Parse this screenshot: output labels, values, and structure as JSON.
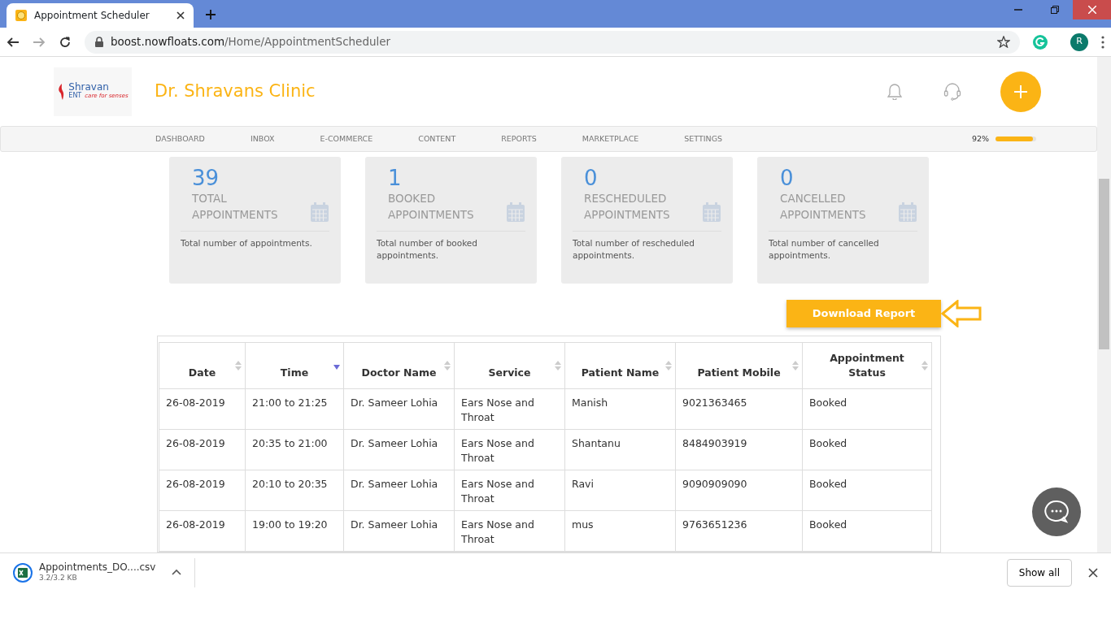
{
  "browser": {
    "tabs": [
      {
        "title": "Appointment Scheduler",
        "selected": true
      }
    ],
    "url_host": "boost.nowfloats.com",
    "url_path": "/Home/AppointmentScheduler",
    "profile_initial": "R"
  },
  "header": {
    "logo_name": "Shravan",
    "logo_sub": "ENT",
    "logo_tagline": "care for senses",
    "clinic_name": "Dr. Shravans Clinic"
  },
  "nav": {
    "items": [
      "DASHBOARD",
      "INBOX",
      "E-COMMERCE",
      "CONTENT",
      "REPORTS",
      "MARKETPLACE",
      "SETTINGS"
    ],
    "completion": "92%",
    "level": 0.92
  },
  "stats": [
    {
      "count": "39",
      "label_1": "TOTAL",
      "label_2": "APPOINTMENTS",
      "description": "Total number of appointments."
    },
    {
      "count": "1",
      "label_1": "BOOKED",
      "label_2": "APPOINTMENTS",
      "description": "Total number of booked appointments."
    },
    {
      "count": "0",
      "label_1": "RESCHEDULED",
      "label_2": "APPOINTMENTS",
      "description": "Total number of rescheduled appointments."
    },
    {
      "count": "0",
      "label_1": "CANCELLED",
      "label_2": "APPOINTMENTS",
      "description": "Total number of cancelled appointments."
    }
  ],
  "download_button": "Download Report",
  "table": {
    "columns": [
      {
        "label": "Date",
        "sorted": false
      },
      {
        "label": "Time",
        "sorted": true
      },
      {
        "label": "Doctor Name",
        "sorted": false
      },
      {
        "label": "Service",
        "sorted": false
      },
      {
        "label": "Patient Name",
        "sorted": false
      },
      {
        "label": "Patient Mobile",
        "sorted": false
      },
      {
        "label": "Appointment Status",
        "sorted": false
      }
    ],
    "rows": [
      [
        "26-08-2019",
        "21:00 to 21:25",
        "Dr. Sameer Lohia",
        "Ears Nose and Throat",
        "Manish",
        "9021363465",
        "Booked"
      ],
      [
        "26-08-2019",
        "20:35 to 21:00",
        "Dr. Sameer Lohia",
        "Ears Nose and Throat",
        "Shantanu",
        "8484903919",
        "Booked"
      ],
      [
        "26-08-2019",
        "20:10 to 20:35",
        "Dr. Sameer Lohia",
        "Ears Nose and Throat",
        "Ravi",
        "9090909090",
        "Booked"
      ],
      [
        "26-08-2019",
        "19:00 to 19:20",
        "Dr. Sameer Lohia",
        "Ears Nose and Throat",
        "mus",
        "9763651236",
        "Booked"
      ]
    ]
  },
  "downloads": {
    "file_name": "Appointments_DO....csv",
    "progress": "3.2/3.2 KB",
    "show_all": "Show all"
  }
}
